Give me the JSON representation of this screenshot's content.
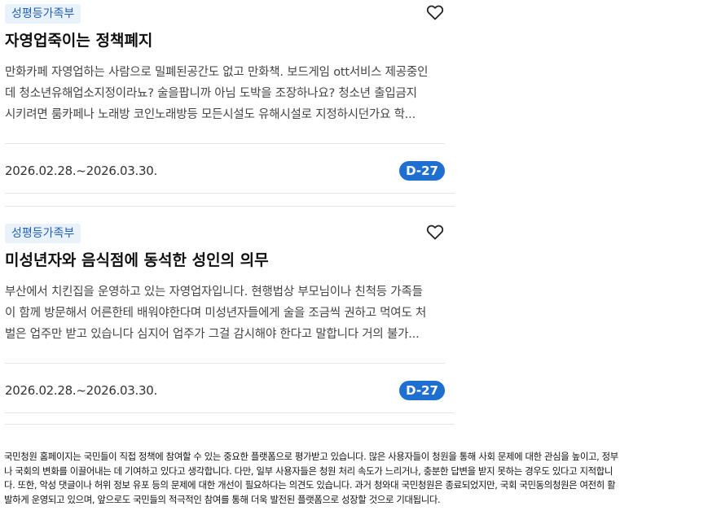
{
  "cards": [
    {
      "category": "성평등가족부",
      "title": "자영업죽이는 정책폐지",
      "body_lines": [
        "만화카페 자영업하는 사람으로 밀폐된공간도 없고 만화책. 보드게임 ott서비스 제공중인",
        "데 청소년유해업소지정이라뇨? 술을팝니까 아님 도박을 조장하나요? 청소년 출입금지",
        "시키려면 룸카페나 노래방 코인노래방등 모든시설도 유해시설로 지정하시던가요 학..."
      ],
      "period": "2026.02.28.~2026.03.30.",
      "dday": "D-27"
    },
    {
      "category": "성평등가족부",
      "title": "미성년자와 음식점에 동석한 성인의 의무",
      "body_lines": [
        "부산에서 치킨집을 운영하고 있는 자영업자입니다. 현행법상 부모님이나 친척등 가족들",
        "이 함께 방문해서 어른한테 배워야한다며 미성년자들에게 술을 조금씩 권하고 먹여도 처",
        "벌은 업주만 받고 있습니다 심지어 업주가 그걸 감시해야 한다고 말합니다 거의 불가..."
      ],
      "period": "2026.02.28.~2026.03.30.",
      "dday": "D-27"
    }
  ],
  "footer": {
    "lines": [
      "국민청원 홈페이지는 국민들이 직접 정책에 참여할 수 있는 중요한 플랫폼으로 평가받고 있습니다. 많은 사용자들이 청원을 통해 사회 문제에 대한 관심을 높이고, 정부",
      "나 국회의 변화를 이끌어내는 데 기여하고 있다고 생각합니다. 다만, 일부 사용자들은 청원 처리 속도가 느리거나, 충분한 답변을 받지 못하는 경우도 있다고 지적합니",
      "다. 또한, 악성 댓글이나 허위 정보 유포 등의 문제에 대한 개선이 필요하다는 의견도 있습니다. 과거 청와대 국민청원은 종료되었지만, 국회 국민동의청원은 여전히 활",
      "발하게 운영되고 있으며, 앞으로도 국민들의 적극적인 참여를 통해 더욱 발전된 플랫폼으로 성장할 것으로 기대됩니다."
    ]
  },
  "icons": {
    "favorite": "heart-outline-icon"
  },
  "colors": {
    "tag_bg": "#e9f1fb",
    "tag_text": "#1f5fb4",
    "dday_bg": "#1f6fd1",
    "divider": "#e4e4e4"
  }
}
